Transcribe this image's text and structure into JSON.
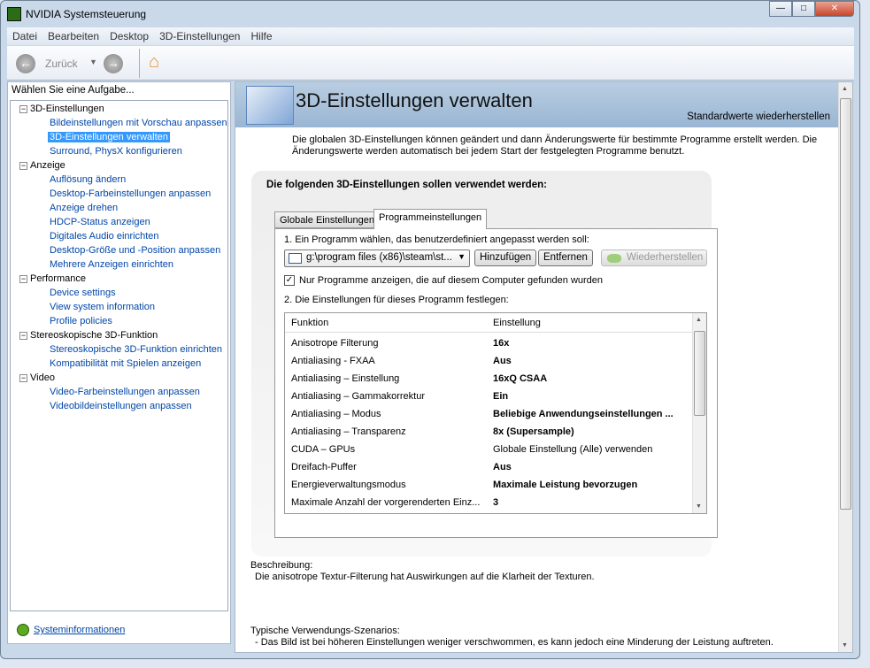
{
  "window": {
    "title": "NVIDIA Systemsteuerung",
    "controls": [
      "—",
      "□",
      "✕"
    ]
  },
  "menu": [
    "Datei",
    "Bearbeiten",
    "Desktop",
    "3D-Einstellungen",
    "Hilfe"
  ],
  "toolbar": {
    "back_label": "Zurück"
  },
  "sidebar": {
    "header": "Wählen Sie eine Aufgabe...",
    "groups": [
      {
        "label": "3D-Einstellungen",
        "items": [
          "Bildeinstellungen mit Vorschau anpassen",
          "3D-Einstellungen verwalten",
          "Surround, PhysX konfigurieren"
        ]
      },
      {
        "label": "Anzeige",
        "items": [
          "Auflösung ändern",
          "Desktop-Farbeinstellungen anpassen",
          "Anzeige drehen",
          "HDCP-Status anzeigen",
          "Digitales Audio einrichten",
          "Desktop-Größe und -Position anpassen",
          "Mehrere Anzeigen einrichten"
        ]
      },
      {
        "label": "Performance",
        "items": [
          "Device settings",
          "View system information",
          "Profile policies"
        ]
      },
      {
        "label": "Stereoskopische 3D-Funktion",
        "items": [
          "Stereoskopische 3D-Funktion einrichten",
          "Kompatibilität mit Spielen anzeigen"
        ]
      },
      {
        "label": "Video",
        "items": [
          "Video-Farbeinstellungen anpassen",
          "Videobildeinstellungen anpassen"
        ]
      }
    ],
    "selected": "3D-Einstellungen verwalten",
    "sysinfo": "Systeminformationen"
  },
  "main": {
    "title": "3D-Einstellungen verwalten",
    "restore_defaults": "Standardwerte wiederherstellen",
    "intro": "Die globalen 3D-Einstellungen können geändert und dann Änderungswerte für bestimmte Programme erstellt werden. Die Änderungswerte werden automatisch bei jedem Start der festgelegten Programme benutzt.",
    "panel_heading": "Die folgenden 3D-Einstellungen sollen verwendet werden:",
    "tabs": [
      "Globale Einstellungen",
      "Programmeinstellungen"
    ],
    "step1": "1. Ein Programm wählen, das benutzerdefiniert angepasst werden soll:",
    "program": "g:\\program files (x86)\\steam\\st...",
    "add": "Hinzufügen",
    "remove": "Entfernen",
    "restore": "Wiederherstellen",
    "checkbox_label": "Nur Programme anzeigen, die auf diesem Computer gefunden wurden",
    "checkbox_checked": true,
    "step2": "2. Die Einstellungen für dieses Programm festlegen:",
    "columns": [
      "Funktion",
      "Einstellung"
    ],
    "rows": [
      {
        "f": "Anisotrope Filterung",
        "v": "16x",
        "bold": true
      },
      {
        "f": "Antialiasing - FXAA",
        "v": "Aus",
        "bold": true
      },
      {
        "f": "Antialiasing – Einstellung",
        "v": "16xQ CSAA",
        "bold": true
      },
      {
        "f": "Antialiasing – Gammakorrektur",
        "v": "Ein",
        "bold": true
      },
      {
        "f": "Antialiasing – Modus",
        "v": "Beliebige Anwendungseinstellungen ...",
        "bold": true
      },
      {
        "f": "Antialiasing – Transparenz",
        "v": "8x (Supersample)",
        "bold": true
      },
      {
        "f": "CUDA – GPUs",
        "v": "Globale Einstellung (Alle) verwenden",
        "bold": false
      },
      {
        "f": "Dreifach-Puffer",
        "v": "Aus",
        "bold": true
      },
      {
        "f": "Energieverwaltungsmodus",
        "v": "Maximale Leistung bevorzugen",
        "bold": true
      },
      {
        "f": "Maximale Anzahl der vorgerenderten Einz...",
        "v": "3",
        "bold": true
      }
    ],
    "desc_label": "Beschreibung:",
    "desc_text": "Die anisotrope Textur-Filterung hat Auswirkungen auf die Klarheit der Texturen.",
    "usage_label": "Typische Verwendungs-Szenarios:",
    "usage_text": "- Das Bild ist bei höheren Einstellungen weniger verschwommen, es kann jedoch eine Minderung der Leistung auftreten."
  }
}
